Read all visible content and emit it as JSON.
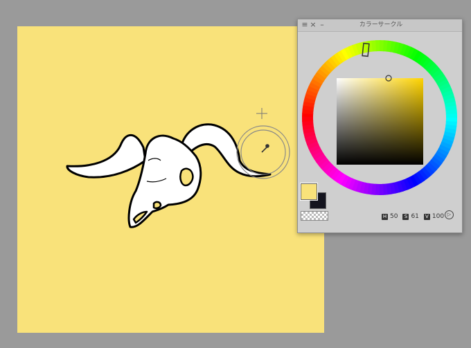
{
  "panel": {
    "title": "カラーサークル",
    "menu_glyph": "≡",
    "close_glyph": "×",
    "minimize_glyph": "–"
  },
  "color": {
    "hue": "50",
    "saturation": "61",
    "value": "100",
    "h_label": "H",
    "s_label": "S",
    "v_label": "V",
    "foreground": "#f9e27a",
    "background": "#14141e"
  },
  "canvas": {
    "fill_color": "#f9e27a"
  },
  "icons": {
    "play": "▷",
    "eyedropper": "eyedropper-icon",
    "crosshair": "crosshair-icon"
  }
}
